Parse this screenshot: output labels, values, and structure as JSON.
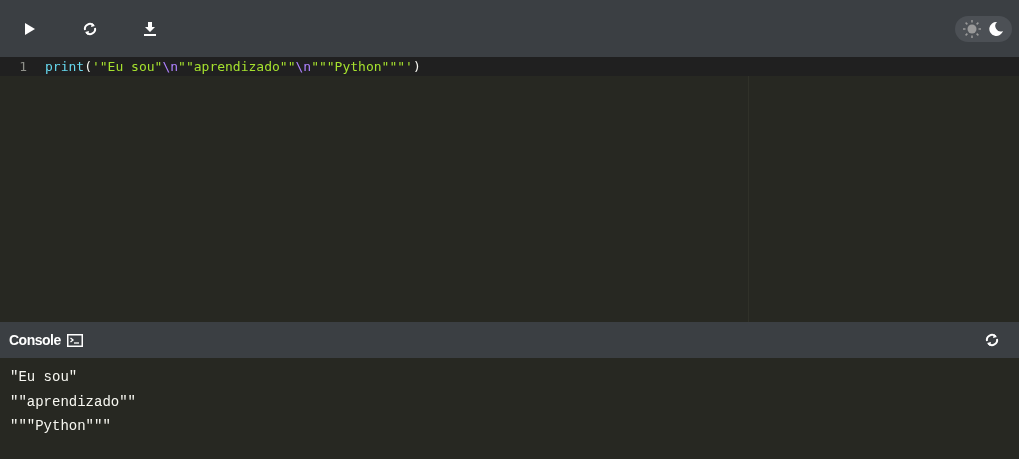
{
  "toolbar": {
    "theme_options": [
      {
        "kind": "light",
        "selected": false
      },
      {
        "kind": "dark",
        "selected": true
      }
    ]
  },
  "editor": {
    "lines": [
      {
        "number": "1",
        "active": true,
        "tokens": [
          {
            "kind": "function",
            "text": "print"
          },
          {
            "kind": "punct",
            "text": "("
          },
          {
            "kind": "string",
            "text": "'\"Eu sou\""
          },
          {
            "kind": "escape",
            "text": "\\n"
          },
          {
            "kind": "string",
            "text": "\"\"aprendizado\"\""
          },
          {
            "kind": "escape",
            "text": "\\n"
          },
          {
            "kind": "string",
            "text": "\"\"\"Python\"\"\"'"
          },
          {
            "kind": "punct",
            "text": ")"
          }
        ]
      }
    ]
  },
  "console": {
    "title": "Console",
    "output": [
      "\"Eu sou\"",
      "\"\"aprendizado\"\"",
      "\"\"\"Python\"\"\""
    ]
  }
}
